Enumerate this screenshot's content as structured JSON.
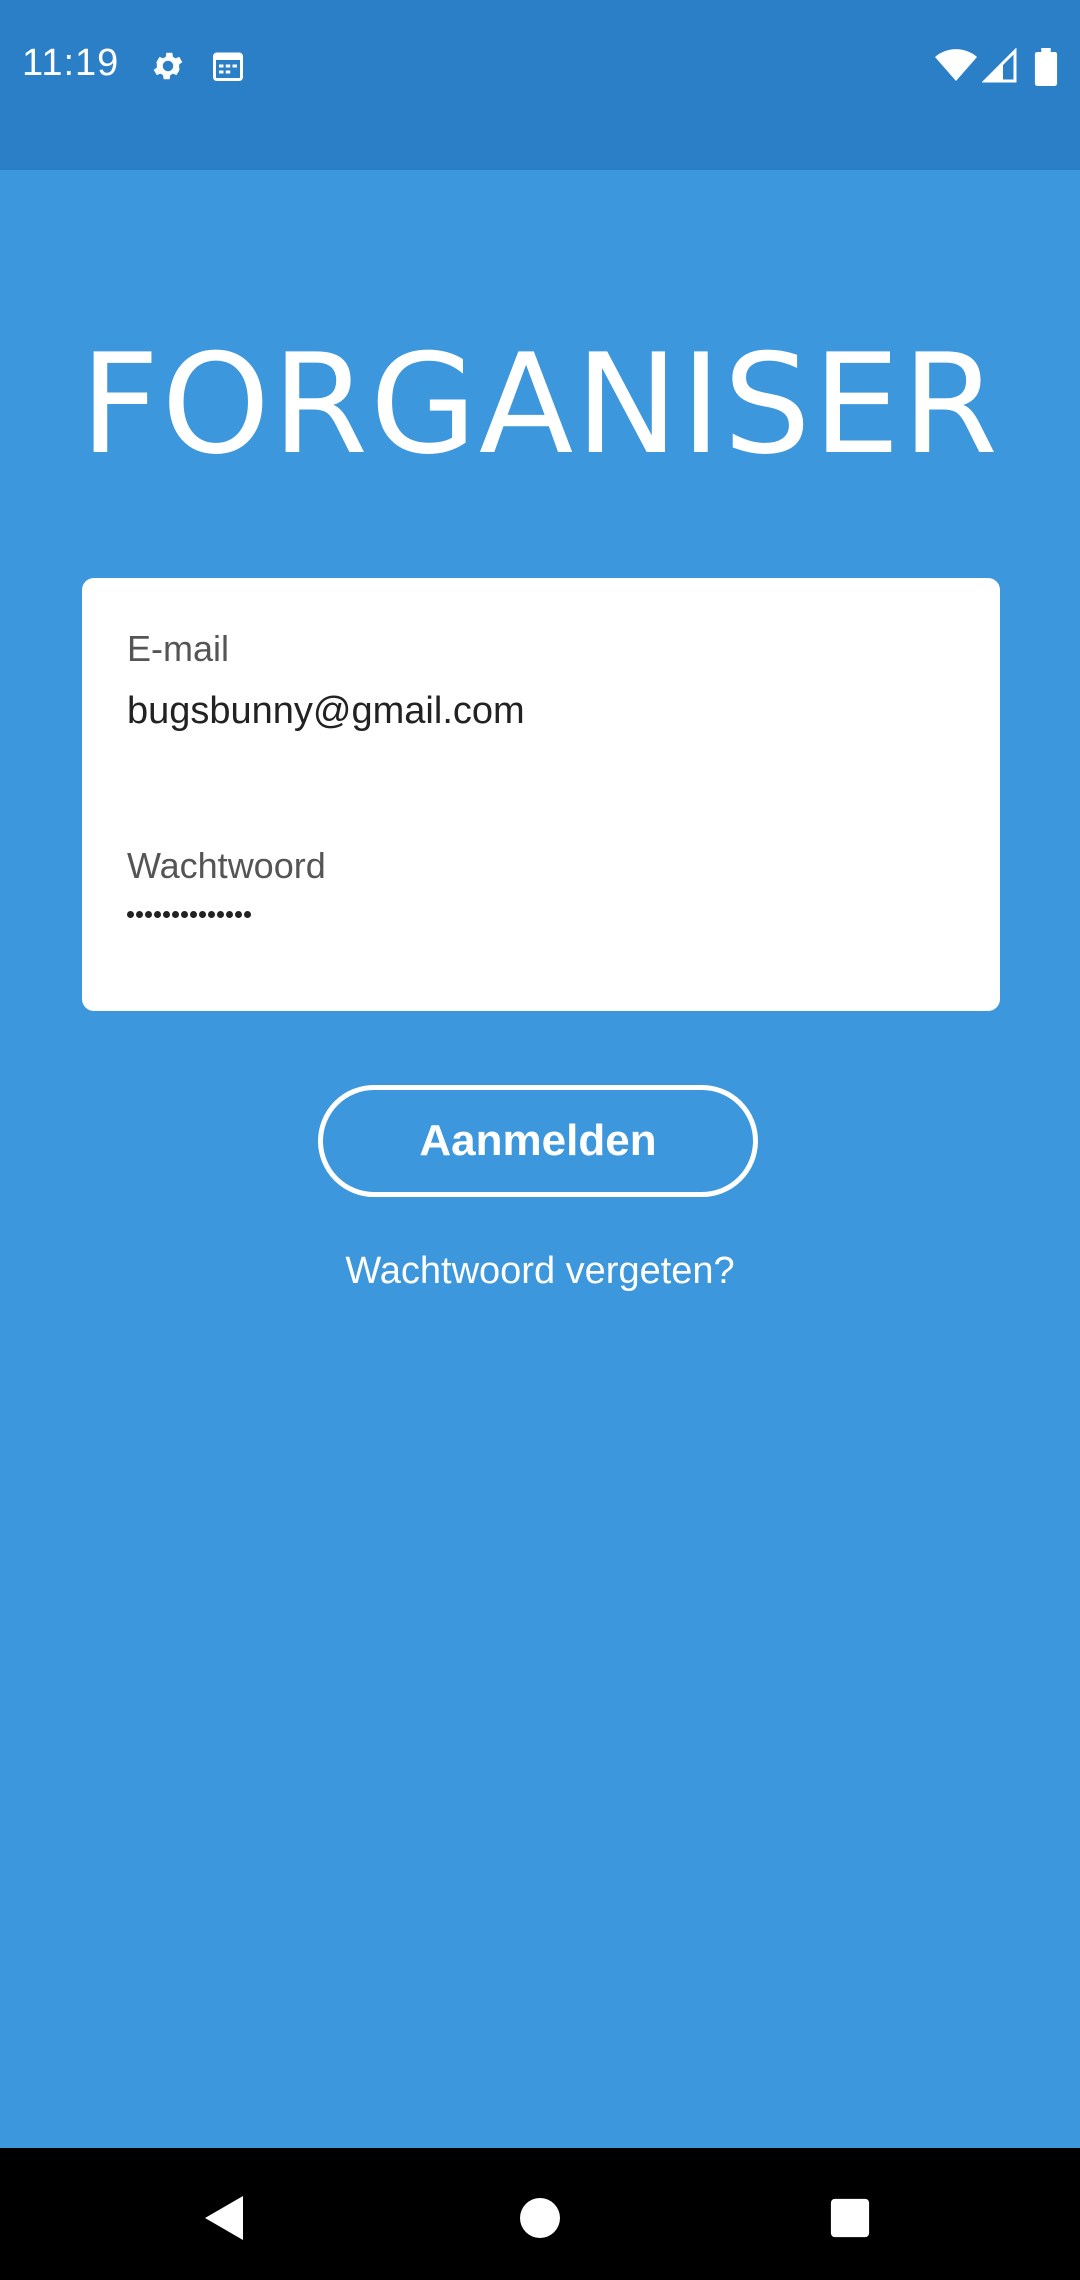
{
  "status_bar": {
    "time": "11:19",
    "icons_left": [
      "gear-icon",
      "calendar-icon"
    ],
    "icons_right": [
      "wifi-icon",
      "signal-icon",
      "battery-icon"
    ]
  },
  "app": {
    "title": "FORGANISER"
  },
  "login_form": {
    "email_label": "E-mail",
    "email_value": "bugsbunny@gmail.com",
    "password_label": "Wachtwoord",
    "password_length": 14,
    "submit_label": "Aanmelden",
    "forgot_label": "Wachtwoord vergeten?"
  },
  "nav_bar": {
    "buttons": [
      "back-icon",
      "home-icon",
      "recents-icon"
    ]
  },
  "colors": {
    "background": "#3d97dc",
    "status_bar": "#2a7fc6",
    "card": "#ffffff",
    "nav_bar": "#000000"
  }
}
